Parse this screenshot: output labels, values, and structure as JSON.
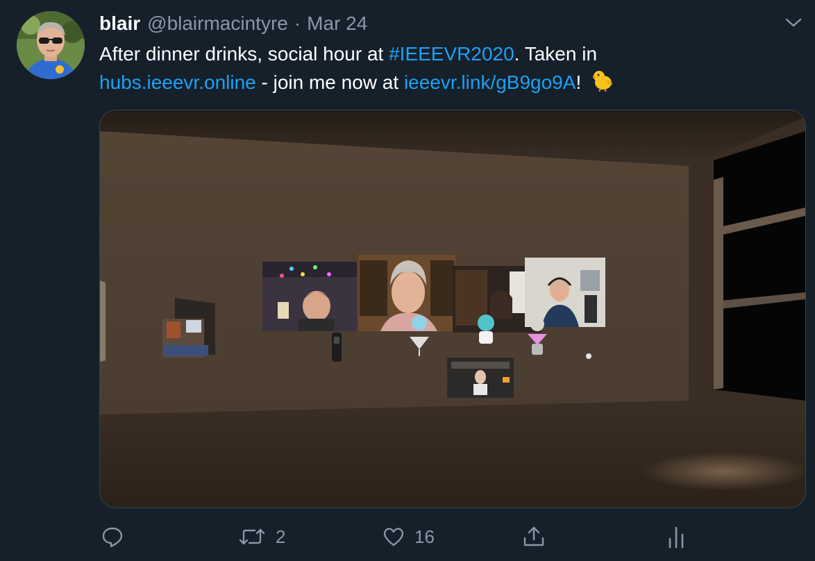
{
  "tweet": {
    "author_name": "blair",
    "handle": "@blairmacintyre",
    "separator": "·",
    "date": "Mar 24",
    "text": {
      "part1": "After dinner drinks, social hour at ",
      "hashtag": "#IEEEVR2020",
      "part2": ".  Taken in",
      "link1": "hubs.ieeevr.online",
      "part3": " - join me now at ",
      "link2": "ieeevr.link/gB9go9A",
      "part4": "!"
    },
    "emoji": "baby-chick-icon"
  },
  "actions": {
    "reply_icon": "reply-icon",
    "retweet_icon": "retweet-icon",
    "retweet_count": "2",
    "like_icon": "heart-icon",
    "like_count": "16",
    "share_icon": "share-icon",
    "analytics_icon": "analytics-icon"
  },
  "colors": {
    "background": "#15202b",
    "link": "#1da1f2",
    "secondary_text": "#8899a6",
    "border": "#38444d"
  }
}
